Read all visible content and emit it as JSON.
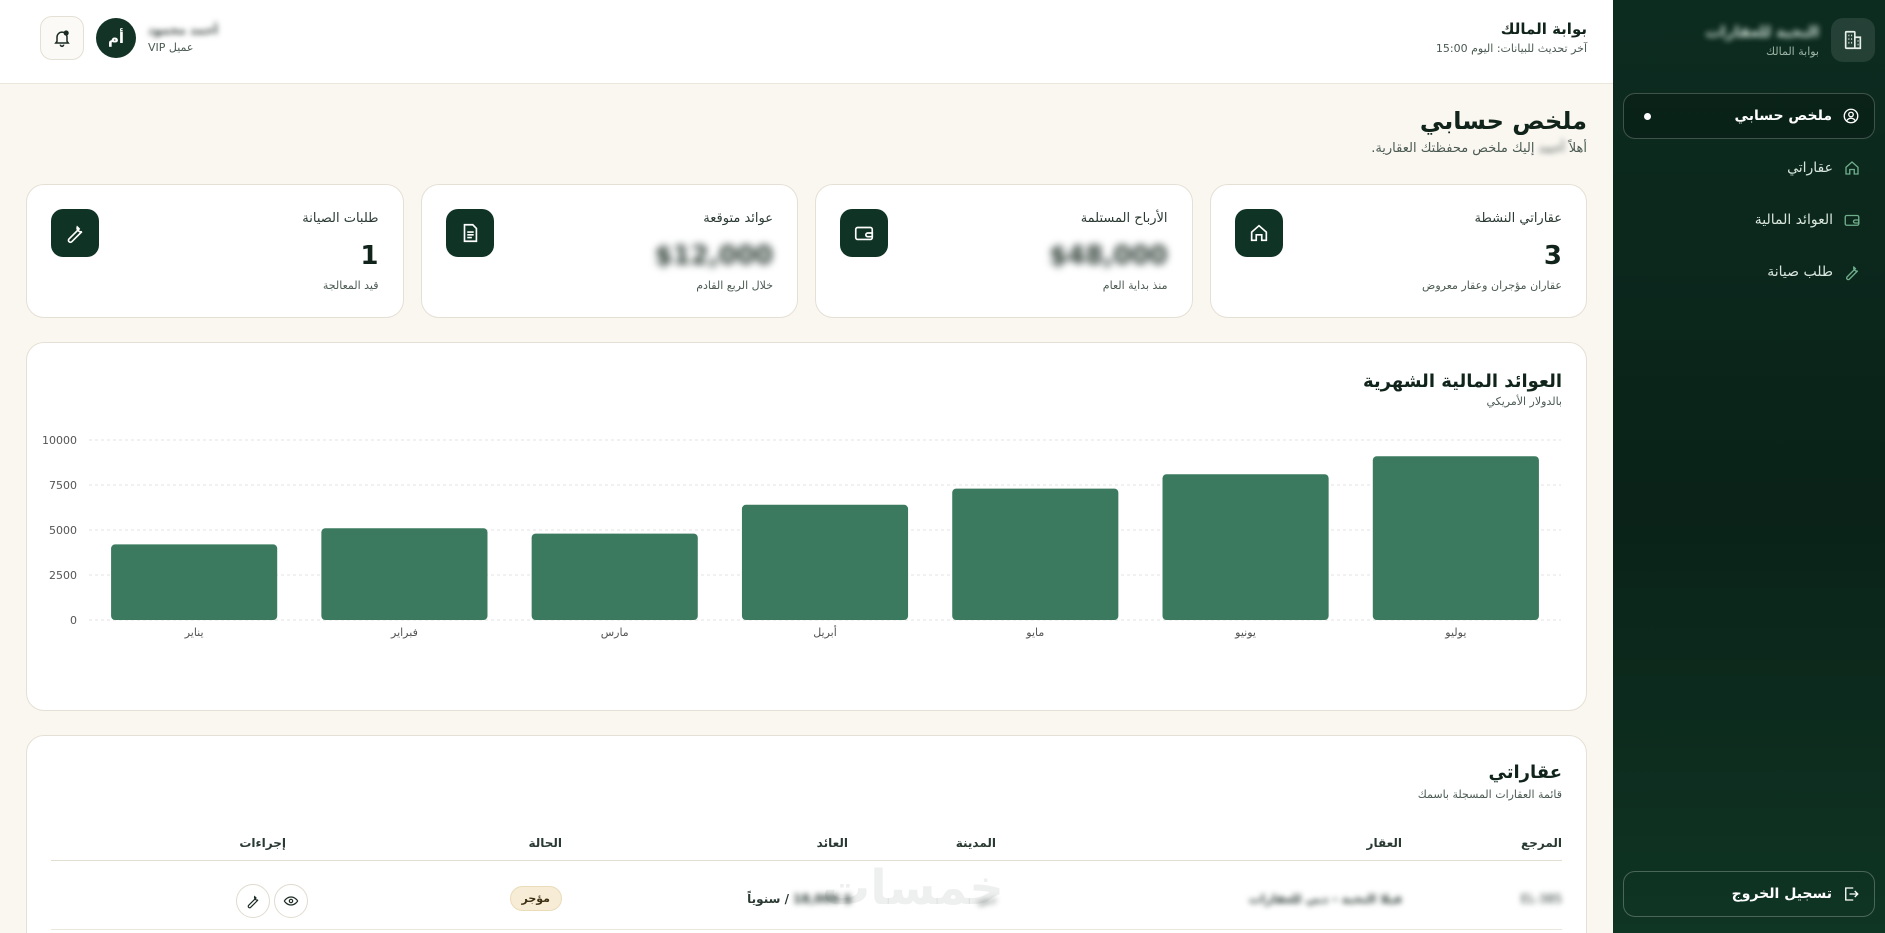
{
  "sidebar": {
    "brand_name": "النخبة للعقارات",
    "brand_sub": "بوابة المالك",
    "items": [
      {
        "label": "ملخص حسابي",
        "icon": "user-circle-icon",
        "active": true
      },
      {
        "label": "عقاراتي",
        "icon": "home-icon",
        "active": false
      },
      {
        "label": "العوائد المالية",
        "icon": "wallet-icon",
        "active": false
      },
      {
        "label": "طلب صيانة",
        "icon": "wrench-icon",
        "active": false
      }
    ],
    "logout": "تسجيل الخروج"
  },
  "header": {
    "title": "بوابة المالك",
    "subtitle": "آخر تحديث للبيانات: اليوم 15:00",
    "user_name": "أحمد محمود",
    "user_role": "عميل VIP",
    "avatar_initials": "أم"
  },
  "page": {
    "title": "ملخص حسابي",
    "greeting_prefix": "أهلاً",
    "greeting_name": "أحمد",
    "greeting_suffix": "إليك ملخص محفظتك العقارية."
  },
  "cards": [
    {
      "title": "عقاراتي النشطة",
      "value": "3",
      "sub": "عقاران مؤجران وعقار معروض",
      "icon": "home-icon"
    },
    {
      "title": "الأرباح المستلمة",
      "value": "$48,000",
      "sub": "منذ بداية العام",
      "icon": "wallet-icon"
    },
    {
      "title": "عوائد متوقعة",
      "value": "$12,000",
      "sub": "خلال الربع القادم",
      "icon": "document-icon"
    },
    {
      "title": "طلبات الصيانة",
      "value": "1",
      "sub": "قيد المعالجة",
      "icon": "wrench-icon"
    }
  ],
  "chart_card": {
    "title": "العوائد المالية الشهرية",
    "subtitle": "بالدولار الأمريكي"
  },
  "chart_data": {
    "type": "bar",
    "categories": [
      "يناير",
      "فبراير",
      "مارس",
      "أبريل",
      "مايو",
      "يونيو",
      "يوليو"
    ],
    "values": [
      4200,
      5100,
      4800,
      6400,
      7300,
      8100,
      9100
    ],
    "ylim": [
      0,
      10000
    ],
    "yticks": [
      0,
      2500,
      5000,
      7500,
      10000
    ],
    "bar_color": "#3b7a5f",
    "grid": true
  },
  "table": {
    "title": "عقاراتي",
    "subtitle": "قائمة العقارات المسجلة باسمك",
    "headers": {
      "ref": "المرجع",
      "property": "العقار",
      "city": "المدينة",
      "revenue": "العائد",
      "status": "الحالة",
      "actions": "إجراءات"
    },
    "rows": [
      {
        "ref": "EL-385",
        "property": "فيلا النخبة - دبي للعقارات",
        "city": "دبي",
        "revenue_amount": "$ 18,000",
        "revenue_period": "/ سنوياً",
        "status": "مؤجر"
      }
    ]
  },
  "watermark": "خمسات",
  "colors": {
    "primary_dark": "#0f3324",
    "bar": "#3b7a5f",
    "status_bg": "#f7ecd6"
  }
}
